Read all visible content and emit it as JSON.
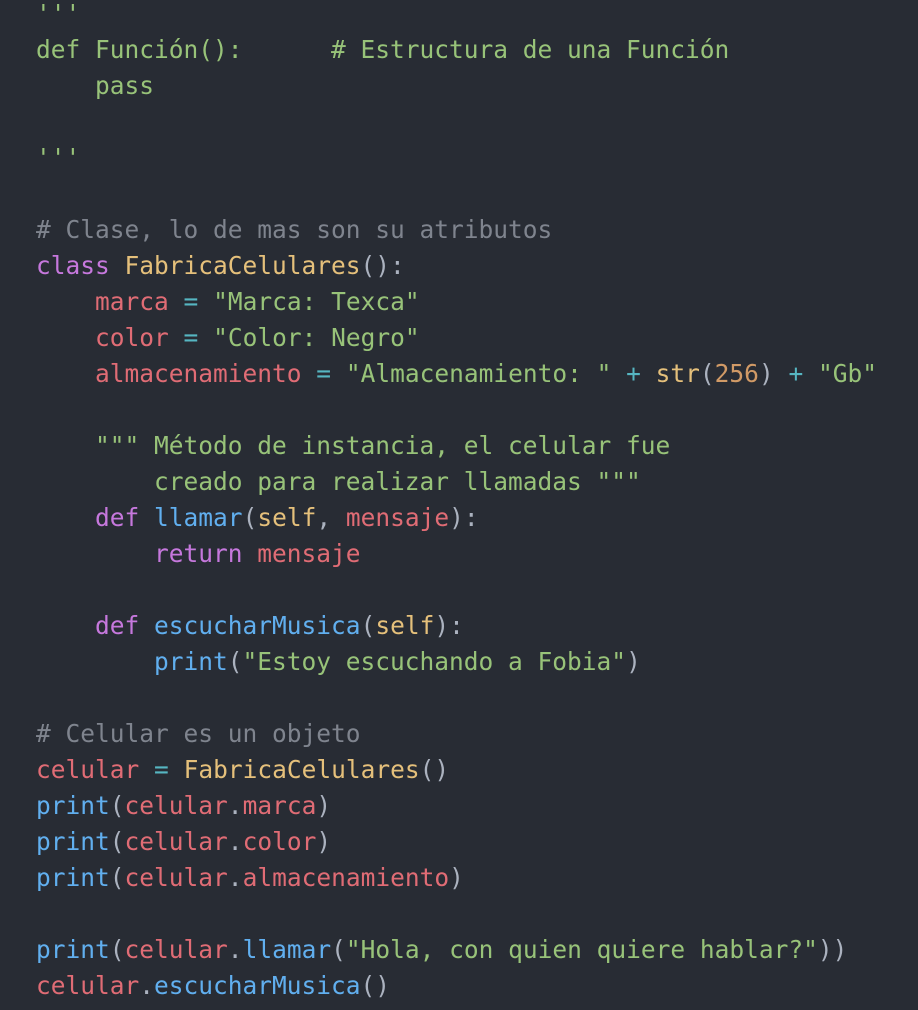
{
  "code": {
    "lines": [
      [
        {
          "t": "'''",
          "c": "doc"
        }
      ],
      [
        {
          "t": "def Función():      # Estructura de una Función",
          "c": "doc"
        }
      ],
      [
        {
          "t": "    pass",
          "c": "doc"
        }
      ],
      [],
      [
        {
          "t": "'''",
          "c": "doc"
        }
      ],
      [],
      [
        {
          "t": "# Clase, lo de mas son su atributos",
          "c": "cm"
        }
      ],
      [
        {
          "t": "class",
          "c": "kw"
        },
        {
          "t": " ",
          "c": "pun"
        },
        {
          "t": "FabricaCelulares",
          "c": "cls"
        },
        {
          "t": "():",
          "c": "pun"
        }
      ],
      [
        {
          "t": "    ",
          "c": "pun"
        },
        {
          "t": "marca",
          "c": "var"
        },
        {
          "t": " ",
          "c": "pun"
        },
        {
          "t": "=",
          "c": "op"
        },
        {
          "t": " ",
          "c": "pun"
        },
        {
          "t": "\"Marca: Texca\"",
          "c": "str"
        }
      ],
      [
        {
          "t": "    ",
          "c": "pun"
        },
        {
          "t": "color",
          "c": "var"
        },
        {
          "t": " ",
          "c": "pun"
        },
        {
          "t": "=",
          "c": "op"
        },
        {
          "t": " ",
          "c": "pun"
        },
        {
          "t": "\"Color: Negro\"",
          "c": "str"
        }
      ],
      [
        {
          "t": "    ",
          "c": "pun"
        },
        {
          "t": "almacenamiento",
          "c": "var"
        },
        {
          "t": " ",
          "c": "pun"
        },
        {
          "t": "=",
          "c": "op"
        },
        {
          "t": " ",
          "c": "pun"
        },
        {
          "t": "\"Almacenamiento: \"",
          "c": "str"
        },
        {
          "t": " ",
          "c": "pun"
        },
        {
          "t": "+",
          "c": "op"
        },
        {
          "t": " ",
          "c": "pun"
        },
        {
          "t": "str",
          "c": "cls"
        },
        {
          "t": "(",
          "c": "pun"
        },
        {
          "t": "256",
          "c": "num"
        },
        {
          "t": ")",
          "c": "pun"
        },
        {
          "t": " ",
          "c": "pun"
        },
        {
          "t": "+",
          "c": "op"
        },
        {
          "t": " ",
          "c": "pun"
        },
        {
          "t": "\"Gb\"",
          "c": "str"
        }
      ],
      [],
      [
        {
          "t": "    \"\"\" Método de instancia, el celular fue",
          "c": "doc"
        }
      ],
      [
        {
          "t": "        creado para realizar llamadas \"\"\"",
          "c": "doc"
        }
      ],
      [
        {
          "t": "    ",
          "c": "pun"
        },
        {
          "t": "def",
          "c": "kw"
        },
        {
          "t": " ",
          "c": "pun"
        },
        {
          "t": "llamar",
          "c": "fn"
        },
        {
          "t": "(",
          "c": "pun"
        },
        {
          "t": "self",
          "c": "cls"
        },
        {
          "t": ", ",
          "c": "pun"
        },
        {
          "t": "mensaje",
          "c": "var"
        },
        {
          "t": "):",
          "c": "pun"
        }
      ],
      [
        {
          "t": "        ",
          "c": "pun"
        },
        {
          "t": "return",
          "c": "kw"
        },
        {
          "t": " ",
          "c": "pun"
        },
        {
          "t": "mensaje",
          "c": "var"
        }
      ],
      [],
      [
        {
          "t": "    ",
          "c": "pun"
        },
        {
          "t": "def",
          "c": "kw"
        },
        {
          "t": " ",
          "c": "pun"
        },
        {
          "t": "escucharMusica",
          "c": "fn"
        },
        {
          "t": "(",
          "c": "pun"
        },
        {
          "t": "self",
          "c": "cls"
        },
        {
          "t": "):",
          "c": "pun"
        }
      ],
      [
        {
          "t": "        ",
          "c": "pun"
        },
        {
          "t": "print",
          "c": "fn"
        },
        {
          "t": "(",
          "c": "pun"
        },
        {
          "t": "\"Estoy escuchando a Fobia\"",
          "c": "str"
        },
        {
          "t": ")",
          "c": "pun"
        }
      ],
      [],
      [
        {
          "t": "# Celular es un objeto",
          "c": "cm"
        }
      ],
      [
        {
          "t": "celular",
          "c": "var"
        },
        {
          "t": " ",
          "c": "pun"
        },
        {
          "t": "=",
          "c": "op"
        },
        {
          "t": " ",
          "c": "pun"
        },
        {
          "t": "FabricaCelulares",
          "c": "cls"
        },
        {
          "t": "()",
          "c": "pun"
        }
      ],
      [
        {
          "t": "print",
          "c": "fn"
        },
        {
          "t": "(",
          "c": "pun"
        },
        {
          "t": "celular",
          "c": "var"
        },
        {
          "t": ".",
          "c": "pun"
        },
        {
          "t": "marca",
          "c": "var"
        },
        {
          "t": ")",
          "c": "pun"
        }
      ],
      [
        {
          "t": "print",
          "c": "fn"
        },
        {
          "t": "(",
          "c": "pun"
        },
        {
          "t": "celular",
          "c": "var"
        },
        {
          "t": ".",
          "c": "pun"
        },
        {
          "t": "color",
          "c": "var"
        },
        {
          "t": ")",
          "c": "pun"
        }
      ],
      [
        {
          "t": "print",
          "c": "fn"
        },
        {
          "t": "(",
          "c": "pun"
        },
        {
          "t": "celular",
          "c": "var"
        },
        {
          "t": ".",
          "c": "pun"
        },
        {
          "t": "almacenamiento",
          "c": "var"
        },
        {
          "t": ")",
          "c": "pun"
        }
      ],
      [],
      [
        {
          "t": "print",
          "c": "fn"
        },
        {
          "t": "(",
          "c": "pun"
        },
        {
          "t": "celular",
          "c": "var"
        },
        {
          "t": ".",
          "c": "pun"
        },
        {
          "t": "llamar",
          "c": "fn"
        },
        {
          "t": "(",
          "c": "pun"
        },
        {
          "t": "\"Hola, con quien quiere hablar?\"",
          "c": "str"
        },
        {
          "t": "))",
          "c": "pun"
        }
      ],
      [
        {
          "t": "celular",
          "c": "var"
        },
        {
          "t": ".",
          "c": "pun"
        },
        {
          "t": "escucharMusica",
          "c": "fn"
        },
        {
          "t": "()",
          "c": "pun"
        }
      ]
    ]
  },
  "theme": {
    "background": "#282c34",
    "keyword": "#c678dd",
    "function": "#61afef",
    "class": "#e5c07b",
    "string": "#98c379",
    "comment": "#7f848e",
    "variable": "#e06c75",
    "number": "#d19a66",
    "operator": "#56b6c2"
  }
}
